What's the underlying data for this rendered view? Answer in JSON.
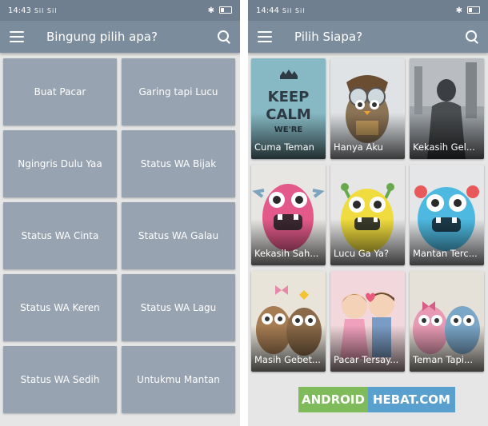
{
  "left": {
    "status": {
      "time": "14:43",
      "signal": "Sil Sil"
    },
    "appbar": {
      "title": "Bingung pilih apa?"
    },
    "buttons": [
      "Buat Pacar",
      "Garing tapi Lucu",
      "Ngingris Dulu Yaa",
      "Status WA Bijak",
      "Status WA Cinta",
      "Status WA Galau",
      "Status WA Keren",
      "Status WA Lagu",
      "Status WA Sedih",
      "Untukmu Mantan"
    ]
  },
  "right": {
    "status": {
      "time": "14:44",
      "signal": "Sil Sil"
    },
    "appbar": {
      "title": "Pilih Siapa?"
    },
    "cards": [
      {
        "label": "Cuma Teman",
        "image": "keep-calm-poster"
      },
      {
        "label": "Hanya Aku",
        "image": "owl-aviator"
      },
      {
        "label": "Kekasih Gel...",
        "image": "woman-photo-grayscale"
      },
      {
        "label": "Kekasih Sah...",
        "image": "pink-monster"
      },
      {
        "label": "Lucu Ga Ya?",
        "image": "yellow-monster"
      },
      {
        "label": "Mantan Terc...",
        "image": "blue-monster"
      },
      {
        "label": "Masih Gebet...",
        "image": "owl-couple-bow"
      },
      {
        "label": "Pacar Tersay...",
        "image": "cartoon-couple"
      },
      {
        "label": "Teman Tapi...",
        "image": "owl-pair"
      }
    ]
  },
  "watermark": {
    "part1": "ANDROID",
    "part2": "HEBAT.COM"
  },
  "colors": {
    "appbar": "#7b8c9c",
    "status": "#6f7f8f",
    "button": "#97a3b1",
    "background": "#e6e6e6"
  }
}
